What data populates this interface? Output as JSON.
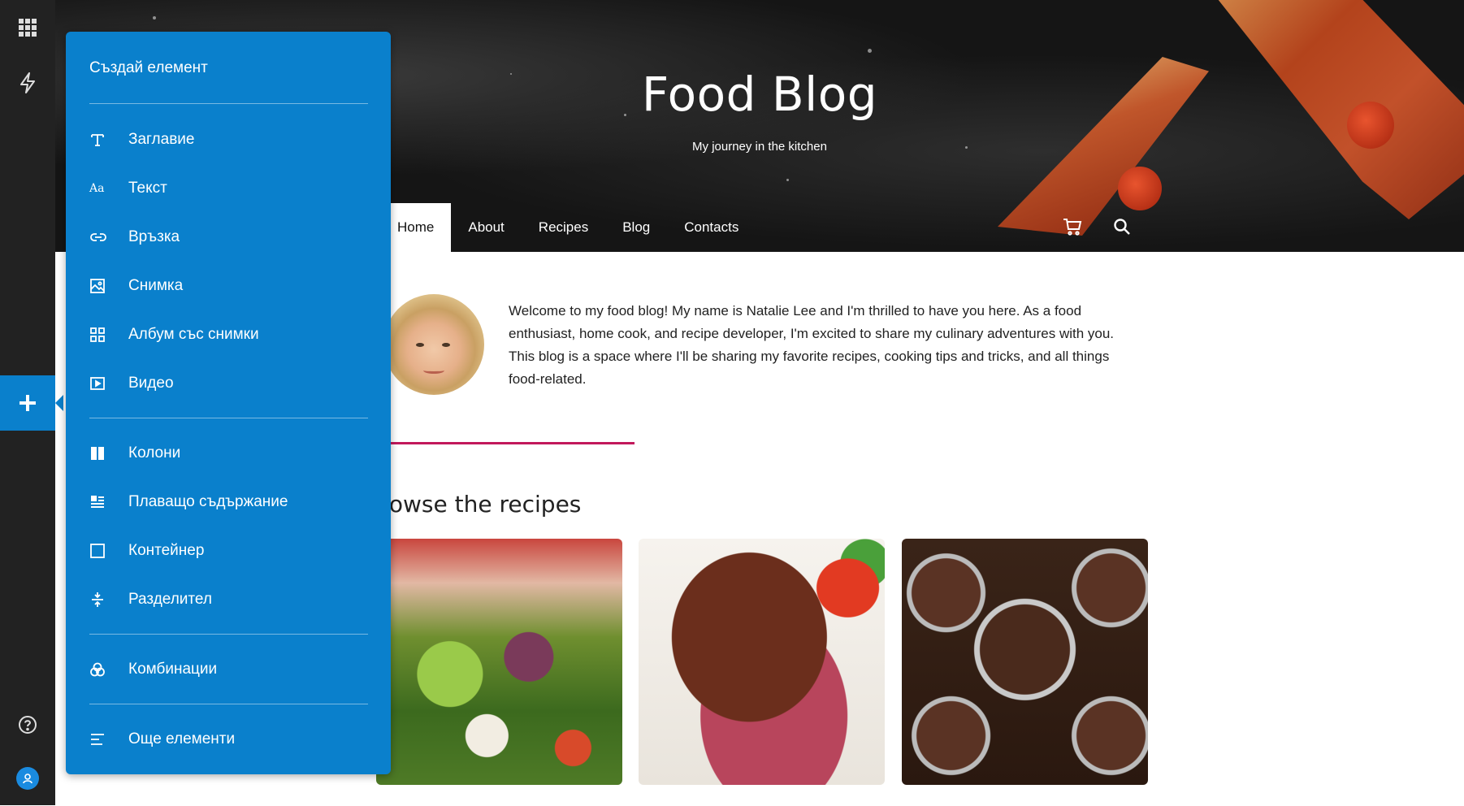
{
  "rail": {
    "items": [
      {
        "name": "apps-grid-icon"
      },
      {
        "name": "lightning-icon"
      },
      {
        "name": "add-icon"
      },
      {
        "name": "help-icon"
      },
      {
        "name": "user-icon"
      }
    ]
  },
  "panel": {
    "title": "Създай елемент",
    "items": [
      {
        "label": "Заглавие",
        "icon": "title-icon"
      },
      {
        "label": "Текст",
        "icon": "text-icon"
      },
      {
        "label": "Връзка",
        "icon": "link-icon"
      },
      {
        "label": "Снимка",
        "icon": "image-icon"
      },
      {
        "label": "Албум със снимки",
        "icon": "gallery-icon"
      },
      {
        "label": "Видео",
        "icon": "video-icon"
      },
      {
        "label": "Колони",
        "icon": "columns-icon"
      },
      {
        "label": "Плаващо съдържание",
        "icon": "floating-content-icon"
      },
      {
        "label": "Контейнер",
        "icon": "container-icon"
      },
      {
        "label": "Разделител",
        "icon": "divider-icon"
      },
      {
        "label": "Комбинации",
        "icon": "combinations-icon"
      },
      {
        "label": "Още елементи",
        "icon": "more-elements-icon"
      }
    ],
    "text_icon_glyph": "Aa"
  },
  "site": {
    "title": "Food Blog",
    "subtitle": "My journey in the kitchen",
    "nav": [
      {
        "label": "Home",
        "active": true
      },
      {
        "label": "About"
      },
      {
        "label": "Recipes"
      },
      {
        "label": "Blog"
      },
      {
        "label": "Contacts"
      }
    ],
    "intro": "Welcome to my food blog! My name is Natalie Lee and I'm thrilled to have you here. As a food enthusiast, home cook, and recipe developer, I'm excited to share my culinary adventures with you. This blog is a space where I'll be sharing my favorite recipes, cooking tips and tricks, and all things food-related.",
    "section_title": "rowse the recipes",
    "accent_color": "#c2185b",
    "panel_color": "#0a80cc"
  }
}
